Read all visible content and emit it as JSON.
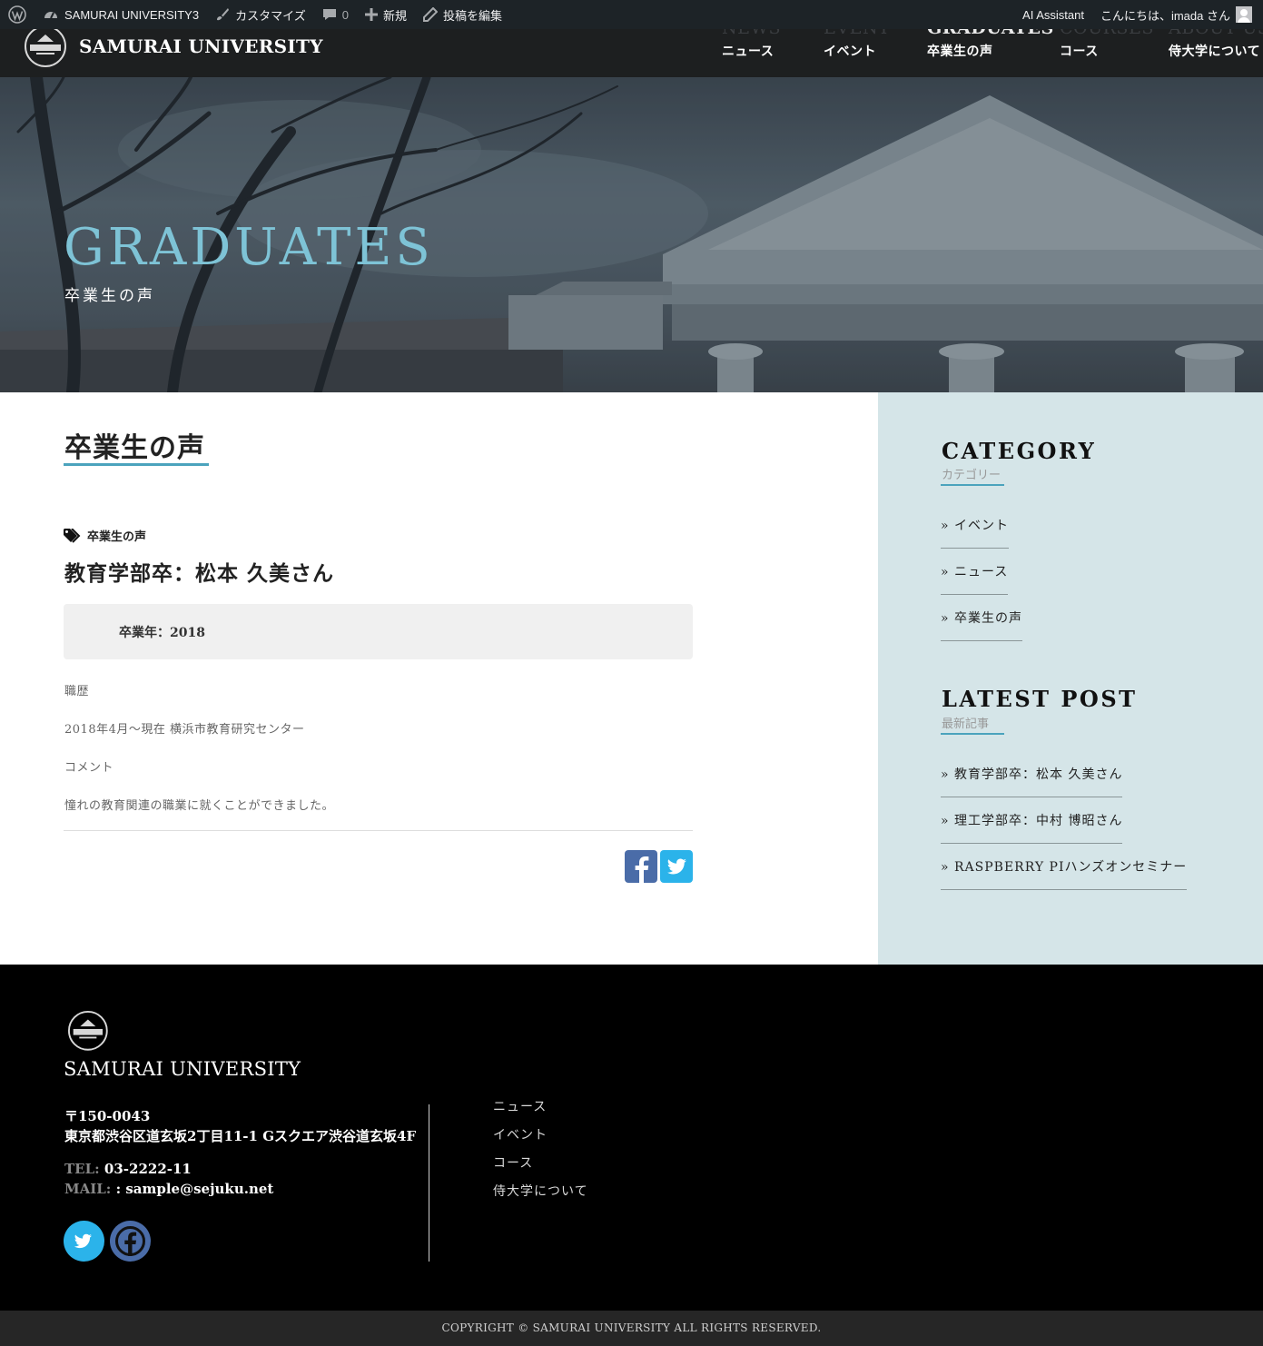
{
  "admin_bar": {
    "site_name": "SAMURAI UNIVERSITY3",
    "customize": "カスタマイズ",
    "comments_count": "0",
    "new": "新規",
    "edit_post": "投稿を編集",
    "ai_assistant": "AI Assistant",
    "greeting": "こんにちは、imada さん"
  },
  "header": {
    "site_title": "SAMURAI UNIVERSITY",
    "nav": [
      {
        "en": "NEWS",
        "jp": "ニュース"
      },
      {
        "en": "EVENT",
        "jp": "イベント"
      },
      {
        "en": "GRADUATES",
        "jp": "卒業生の声"
      },
      {
        "en": "COURSES",
        "jp": "コース"
      },
      {
        "en": "ABOUT US",
        "jp": "侍大学について"
      }
    ]
  },
  "hero": {
    "title": "GRADUATES",
    "subtitle": "卒業生の声"
  },
  "main": {
    "heading": "卒業生の声",
    "post": {
      "category": "卒業生の声",
      "title": "教育学部卒：松本 久美さん",
      "graduation_year": "卒業年：2018",
      "paragraphs": [
        "職歴",
        "2018年4月～現在 横浜市教育研究センター",
        "コメント",
        "憧れの教育関連の職業に就くことができました。"
      ]
    }
  },
  "sidebar": {
    "category_title": "CATEGORY",
    "category_sub": "カテゴリー",
    "categories": [
      "» イベント",
      "» ニュース",
      "» 卒業生の声"
    ],
    "latest_title": "LATEST POST",
    "latest_sub": "最新記事",
    "latest_posts": [
      "» 教育学部卒：松本 久美さん",
      "» 理工学部卒：中村 博昭さん",
      "» RASPBERRY PIハンズオンセミナー"
    ]
  },
  "footer": {
    "title": "SAMURAI UNIVERSITY",
    "postal": "〒150-0043",
    "address": "東京都渋谷区道玄坂2丁目11-1 Gスクエア渋谷道玄坂4F",
    "tel_label": "TEL:",
    "tel": "03-2222-11",
    "mail_label": "MAIL:",
    "mail": ": sample@sejuku.net",
    "nav": [
      "ニュース",
      "イベント",
      "コース",
      "侍大学について"
    ],
    "copyright": "COPYRIGHT © SAMURAI UNIVERSITY ALL RIGHTS RESERVED."
  },
  "colors": {
    "accent": "#4ba3bd",
    "hero_title": "#7ec3d6",
    "sidebar_bg": "#d5e5e8",
    "facebook": "#4a6ca8",
    "twitter": "#2bb3ea"
  }
}
